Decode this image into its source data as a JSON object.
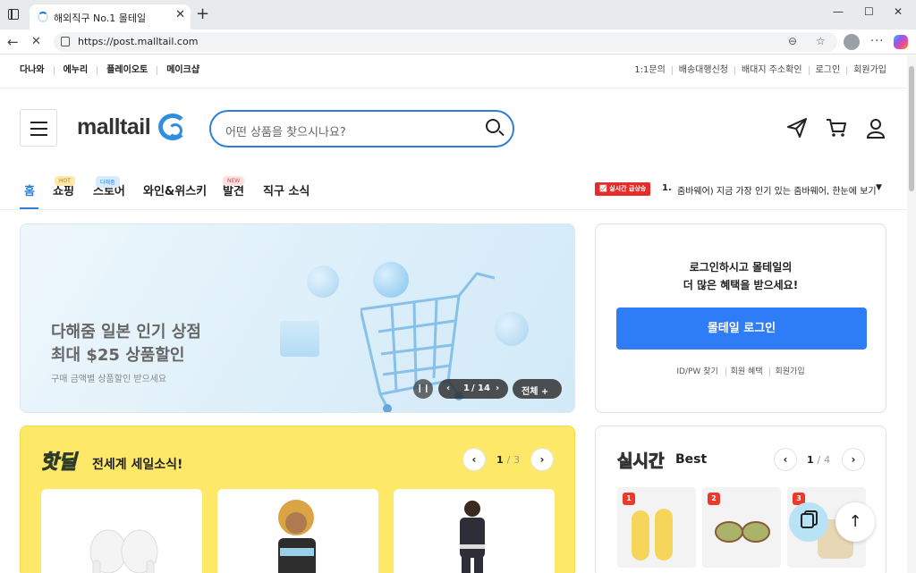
{
  "browser": {
    "tab_title": "해외직구 No.1 몰테일",
    "tab_close": "✕",
    "new_tab": "+",
    "url": "https://post.malltail.com",
    "win_min": "—",
    "win_max": "☐",
    "win_close": "✕",
    "back": "←",
    "reload": "✕",
    "more": "···"
  },
  "util": {
    "left": [
      "다나와",
      "에누리",
      "플레이오토",
      "메이크샵"
    ],
    "right": [
      "1:1문의",
      "배송대행신청",
      "배대지 주소확인",
      "로그인",
      "회원가입"
    ]
  },
  "header": {
    "logo": "malltail",
    "search_placeholder": "어떤 상품을 찾으시나요?"
  },
  "gnb": {
    "items": [
      {
        "label": "홈",
        "badge": ""
      },
      {
        "label": "쇼핑",
        "badge": "HOT"
      },
      {
        "label": "스토어",
        "badge": "다해줌"
      },
      {
        "label": "와인&위스키",
        "badge": ""
      },
      {
        "label": "발견",
        "badge": "NEW"
      },
      {
        "label": "직구 소식",
        "badge": ""
      }
    ],
    "realtime_badge": "📈 실시간 급상승",
    "realtime_rank": "1.",
    "realtime_text": "줌바웨어) 지금 가장 인기 있는 줌바웨어, 한눈에 보기",
    "realtime_caret": "▼"
  },
  "banner": {
    "title_line1": "다해줌 일본 인기 상점",
    "title_line2": "최대 $25 상품할인",
    "subtitle": "구매 금액별 상품할인 받으세요",
    "pause": "❙❙",
    "prev": "‹",
    "page_current": "1",
    "page_total": "14",
    "next": "›",
    "all_label": "전체 +"
  },
  "login": {
    "msg_line1": "로그인하시고 몰테일의",
    "msg_line2": "더 많은 혜택을 받으세요!",
    "button": "몰테일 로그인",
    "links": [
      "ID/PW 찾기",
      "회원 혜택",
      "회원가입"
    ]
  },
  "hotdeal": {
    "logo": "핫딜",
    "title": "전세계 세일소식!",
    "prev": "‹",
    "page": "1",
    "total": "3",
    "next": "›"
  },
  "best": {
    "logo": "실시간",
    "title": "Best",
    "prev": "‹",
    "page": "1",
    "total": "4",
    "next": "›",
    "ranks": [
      "1",
      "2",
      "3"
    ]
  },
  "fab": {
    "top": "↑"
  }
}
